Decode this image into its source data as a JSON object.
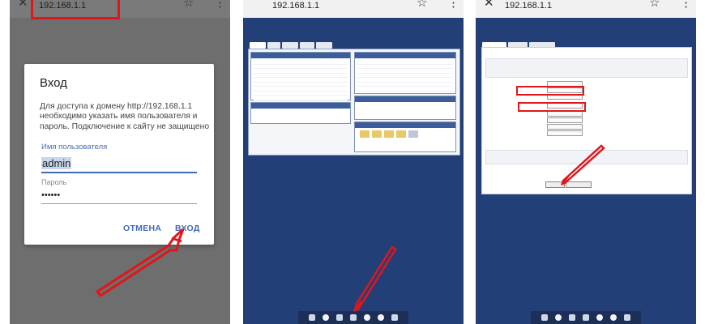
{
  "panel1": {
    "url": "192.168.1.1",
    "dialog": {
      "title": "Вход",
      "message": "Для доступа к домену http://192.168.1.1 необходимо указать имя пользователя и пароль. Подключение к сайту не защищено",
      "username_label": "Имя пользователя",
      "username_value": "admin",
      "password_label": "Пароль",
      "password_value": "••••••",
      "cancel_label": "ОТМЕНА",
      "login_label": "ВХОД"
    }
  },
  "panel2": {
    "url": "192.168.1.1"
  },
  "panel3": {
    "url": "192.168.1.1"
  },
  "icons": {
    "close": "close-icon",
    "bookmark": "bookmark-icon",
    "menu": "more-vertical-icon"
  },
  "colors": {
    "highlight": "#e0161a",
    "dialog_accent": "#3f6ab5",
    "router_bg": "#233f78"
  }
}
